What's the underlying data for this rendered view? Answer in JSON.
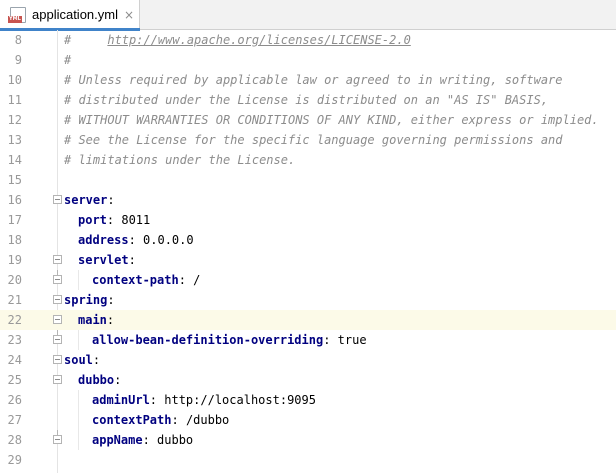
{
  "tab": {
    "file_name": "application.yml",
    "icon": "yml-file-icon",
    "close": "×",
    "badge": "YML"
  },
  "lines": [
    {
      "n": "8",
      "text": "#     ",
      "link": "http://www.apache.org/licenses/LICENSE-2.0"
    },
    {
      "n": "9",
      "text": "#"
    },
    {
      "n": "10",
      "text": "# Unless required by applicable law or agreed to in writing, software"
    },
    {
      "n": "11",
      "text": "# distributed under the License is distributed on an \"AS IS\" BASIS,"
    },
    {
      "n": "12",
      "text": "# WITHOUT WARRANTIES OR CONDITIONS OF ANY KIND, either express or implied."
    },
    {
      "n": "13",
      "text": "# See the License for the specific language governing permissions and"
    },
    {
      "n": "14",
      "text": "# limitations under the License."
    },
    {
      "n": "15"
    },
    {
      "n": "16",
      "key": "server",
      "sep": ":"
    },
    {
      "n": "17",
      "key": "port",
      "sep": ": ",
      "val": "8011"
    },
    {
      "n": "18",
      "key": "address",
      "sep": ": ",
      "val": "0.0.0.0"
    },
    {
      "n": "19",
      "key": "servlet",
      "sep": ":"
    },
    {
      "n": "20",
      "key": "context-path",
      "sep": ": ",
      "val": "/"
    },
    {
      "n": "21",
      "key": "spring",
      "sep": ":"
    },
    {
      "n": "22",
      "key": "main",
      "sep": ":"
    },
    {
      "n": "23",
      "key": "allow-bean-definition-overriding",
      "sep": ": ",
      "val": "true"
    },
    {
      "n": "24",
      "key": "soul",
      "sep": ":"
    },
    {
      "n": "25",
      "key": "dubbo",
      "sep": ":"
    },
    {
      "n": "26",
      "key": "adminUrl",
      "sep": ": ",
      "val": "http://localhost:9095"
    },
    {
      "n": "27",
      "key": "contextPath",
      "sep": ": ",
      "val": "/dubbo"
    },
    {
      "n": "28",
      "key": "appName",
      "sep": ": ",
      "val": "dubbo"
    },
    {
      "n": "29"
    }
  ],
  "colors": {
    "comment": "#8c8c8c",
    "key": "#000080",
    "current_line": "#fcfae8",
    "tab_accent": "#4083c9"
  }
}
